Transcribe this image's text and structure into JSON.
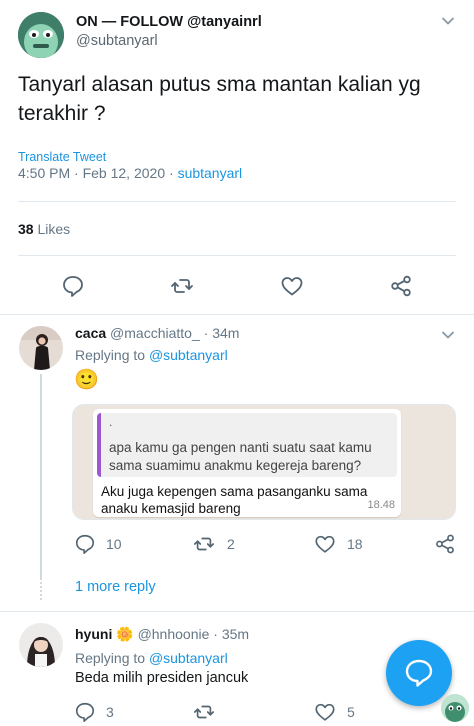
{
  "tweet": {
    "author_name": "ON — FOLLOW @tanyainrl",
    "author_handle": "@subtanyarl",
    "text": "Tanyarl alasan putus sma mantan kalian yg terakhir ?",
    "translate_label": "Translate Tweet",
    "time": "4:50 PM",
    "date": "Feb 12, 2020",
    "source": "subtanyarl",
    "like_count": "38",
    "like_label": "Likes"
  },
  "actions": [
    "reply-icon",
    "retweet-icon",
    "like-icon",
    "share-icon"
  ],
  "replies": [
    {
      "name": "caca",
      "handle": "@macchiatto_",
      "time": "34m",
      "replying_prefix": "Replying to",
      "replying_to": "@subtanyarl",
      "emoji": "🙂",
      "image": {
        "quote_dot": ".",
        "quote_text": "apa kamu ga pengen nanti suatu saat kamu sama suamimu anakmu kegereja bareng?",
        "message": "Aku juga kepengen sama pasanganku sama anaku kemasjid bareng",
        "time": "18.48"
      },
      "reply_count": "10",
      "retweet_count": "2",
      "like_count": "18"
    },
    {
      "name": "hyuni",
      "name_emoji": "🌼",
      "handle": "@hnhoonie",
      "time": "35m",
      "replying_prefix": "Replying to",
      "replying_to": "@subtanyarl",
      "text": "Beda milih presiden jancuk",
      "reply_count": "3",
      "like_count": "5"
    }
  ],
  "more_replies_label": "1 more reply",
  "separator": "·",
  "colors": {
    "accent": "#1da1f2",
    "link": "#1b95e0",
    "muted": "#657786",
    "divider": "#e1e8ed"
  }
}
